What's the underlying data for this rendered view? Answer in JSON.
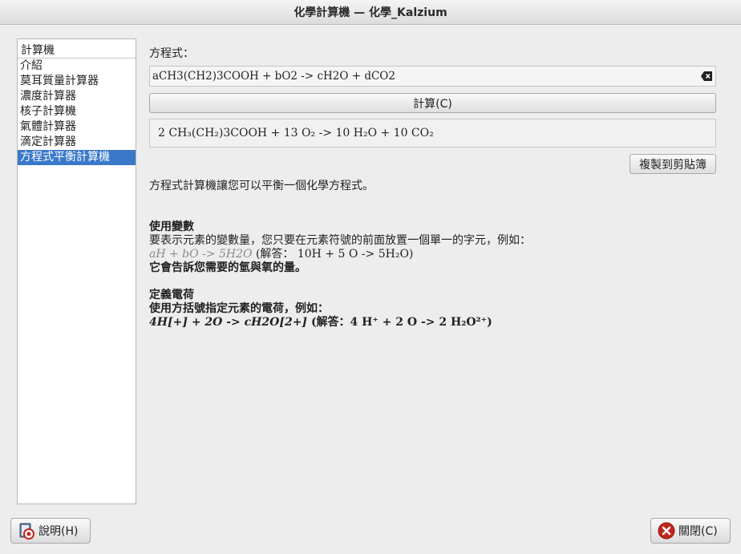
{
  "window": {
    "title": "化學計算機 — 化學_Kalzium"
  },
  "sidebar": {
    "header": "計算機",
    "items": [
      {
        "label": "介紹"
      },
      {
        "label": "莫耳質量計算器"
      },
      {
        "label": "濃度計算器"
      },
      {
        "label": "核子計算機"
      },
      {
        "label": "氣體計算器"
      },
      {
        "label": "滴定計算器"
      },
      {
        "label": "方程式平衡計算機",
        "selected": true
      }
    ]
  },
  "main": {
    "equation_label": "方程式：",
    "equation_value": "aCH3(CH2)3COOH + bO2 -> cH2O + dCO2",
    "calculate_label": "計算(C)",
    "result": "2 CH₃(CH₂)3COOH + 13 O₂ -> 10 H₂O + 10 CO₂",
    "copy_label": "複製到剪貼簿"
  },
  "help": {
    "intro": "方程式計算機讓您可以平衡一個化學方程式。",
    "variables_heading": "使用變數",
    "variables_text": "要表示元素的變數量，您只要在元素符號的前面放置一個單一的字元，例如：",
    "variables_example": "aH + bO -> 5H2O",
    "variables_answer": "(解答： 10H + 5 O -> 5H₂O)",
    "variables_note": "它會告訴您需要的氫與氧的量。",
    "charge_heading": "定義電荷",
    "charge_text": "使用方括號指定元素的電荷，例如：",
    "charge_example": "4H[+] + 2O -> cH2O[2+]",
    "charge_answer": "(解答：4 H⁺ + 2 O -> 2 H₂O²⁺)"
  },
  "footer": {
    "help_label": "說明(H)",
    "close_label": "關閉(C)"
  },
  "colors": {
    "selection": "#3a79c9",
    "close_icon": "#c0261c"
  }
}
